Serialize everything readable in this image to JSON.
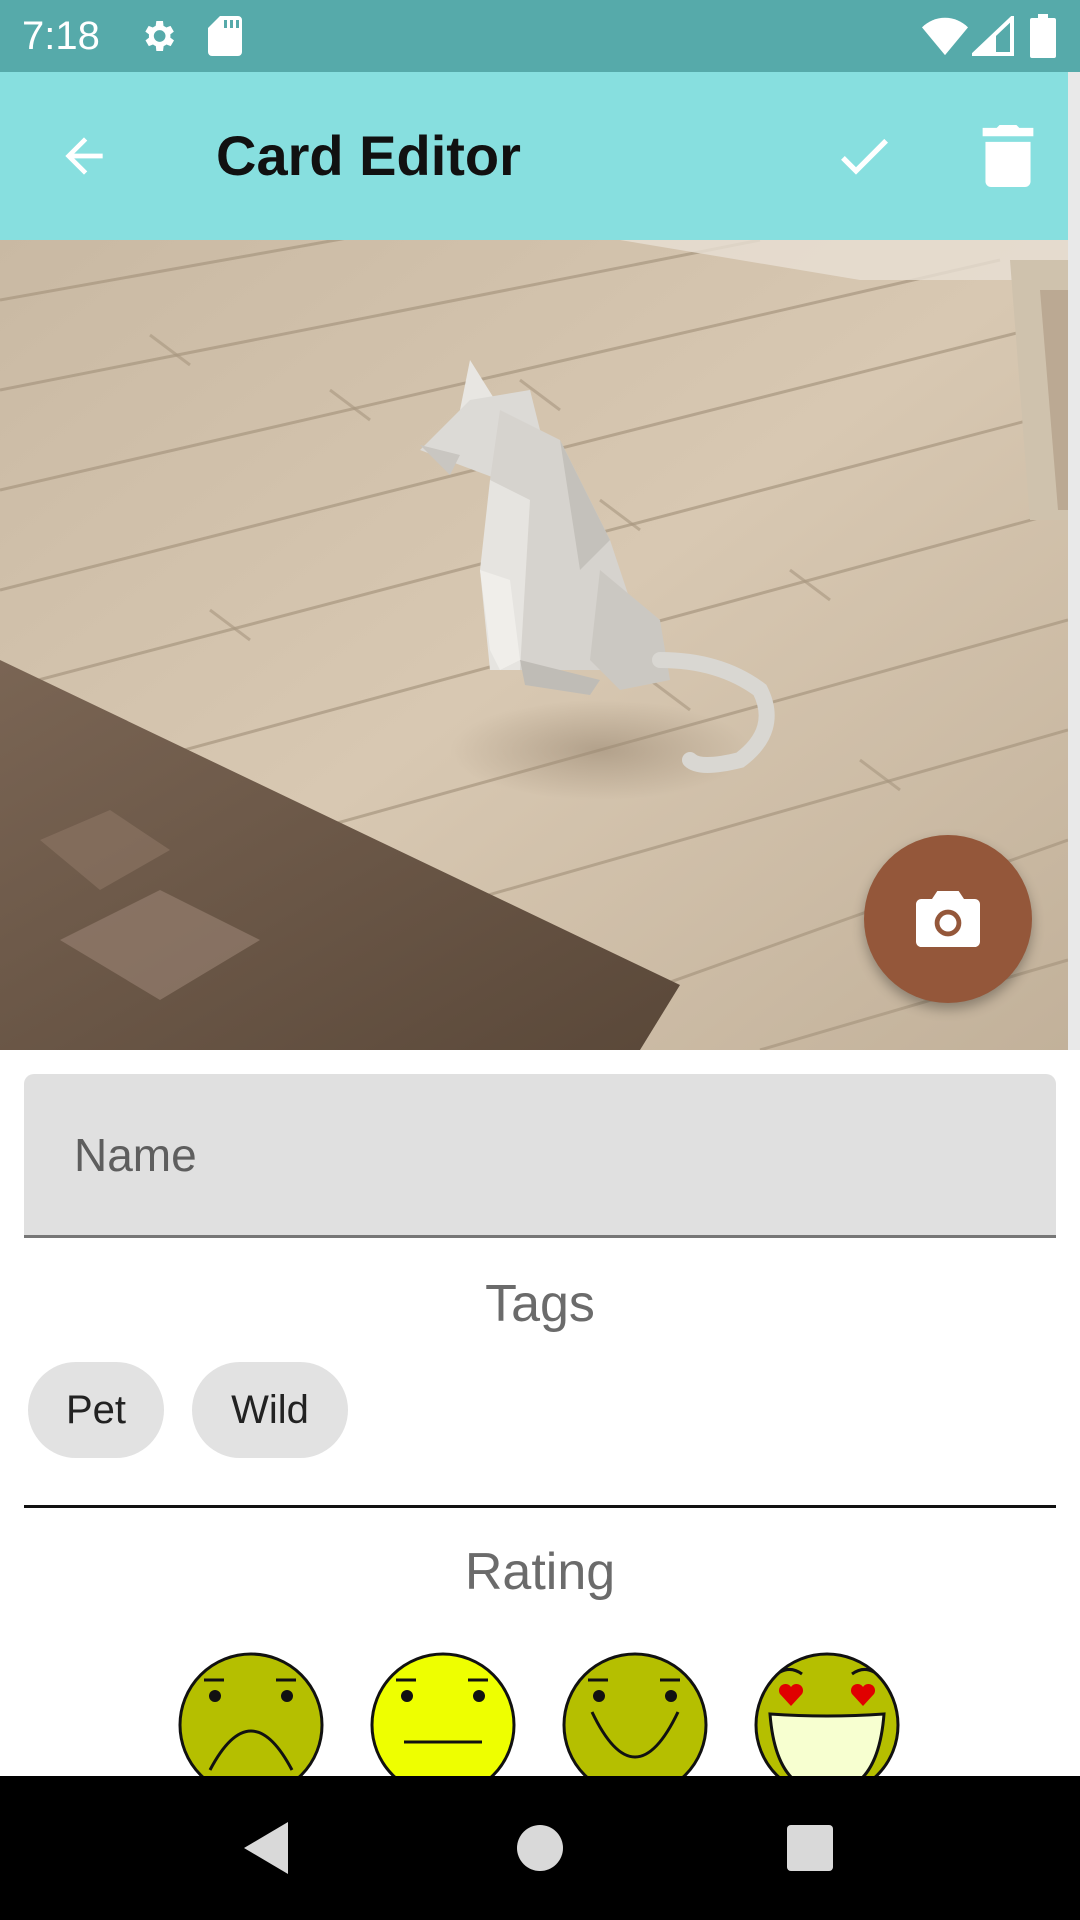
{
  "status_bar": {
    "time": "7:18",
    "icons": [
      "settings-icon",
      "sd-card-icon",
      "wifi-icon",
      "signal-icon",
      "battery-icon"
    ]
  },
  "app_bar": {
    "title": "Card Editor",
    "back_icon": "arrow-left-icon",
    "save_icon": "check-icon",
    "delete_icon": "trash-icon"
  },
  "photo": {
    "description_icon": "photo",
    "camera_button_icon": "camera-icon"
  },
  "form": {
    "name_placeholder": "Name",
    "name_value": "",
    "tags_label": "Tags",
    "tags": [
      "Pet",
      "Wild"
    ],
    "rating_label": "Rating",
    "rating_options": [
      "sad-face-icon",
      "neutral-face-icon",
      "smile-face-icon",
      "love-face-icon"
    ]
  },
  "nav_bar": {
    "buttons": [
      "back-triangle-icon",
      "home-circle-icon",
      "recents-square-icon"
    ]
  },
  "colors": {
    "status_bar": "#56aaaa",
    "app_bar": "#87dfdf",
    "fab": "#94573a",
    "face_yellow": "#b5bf00",
    "face_selected": "#eeff00"
  }
}
